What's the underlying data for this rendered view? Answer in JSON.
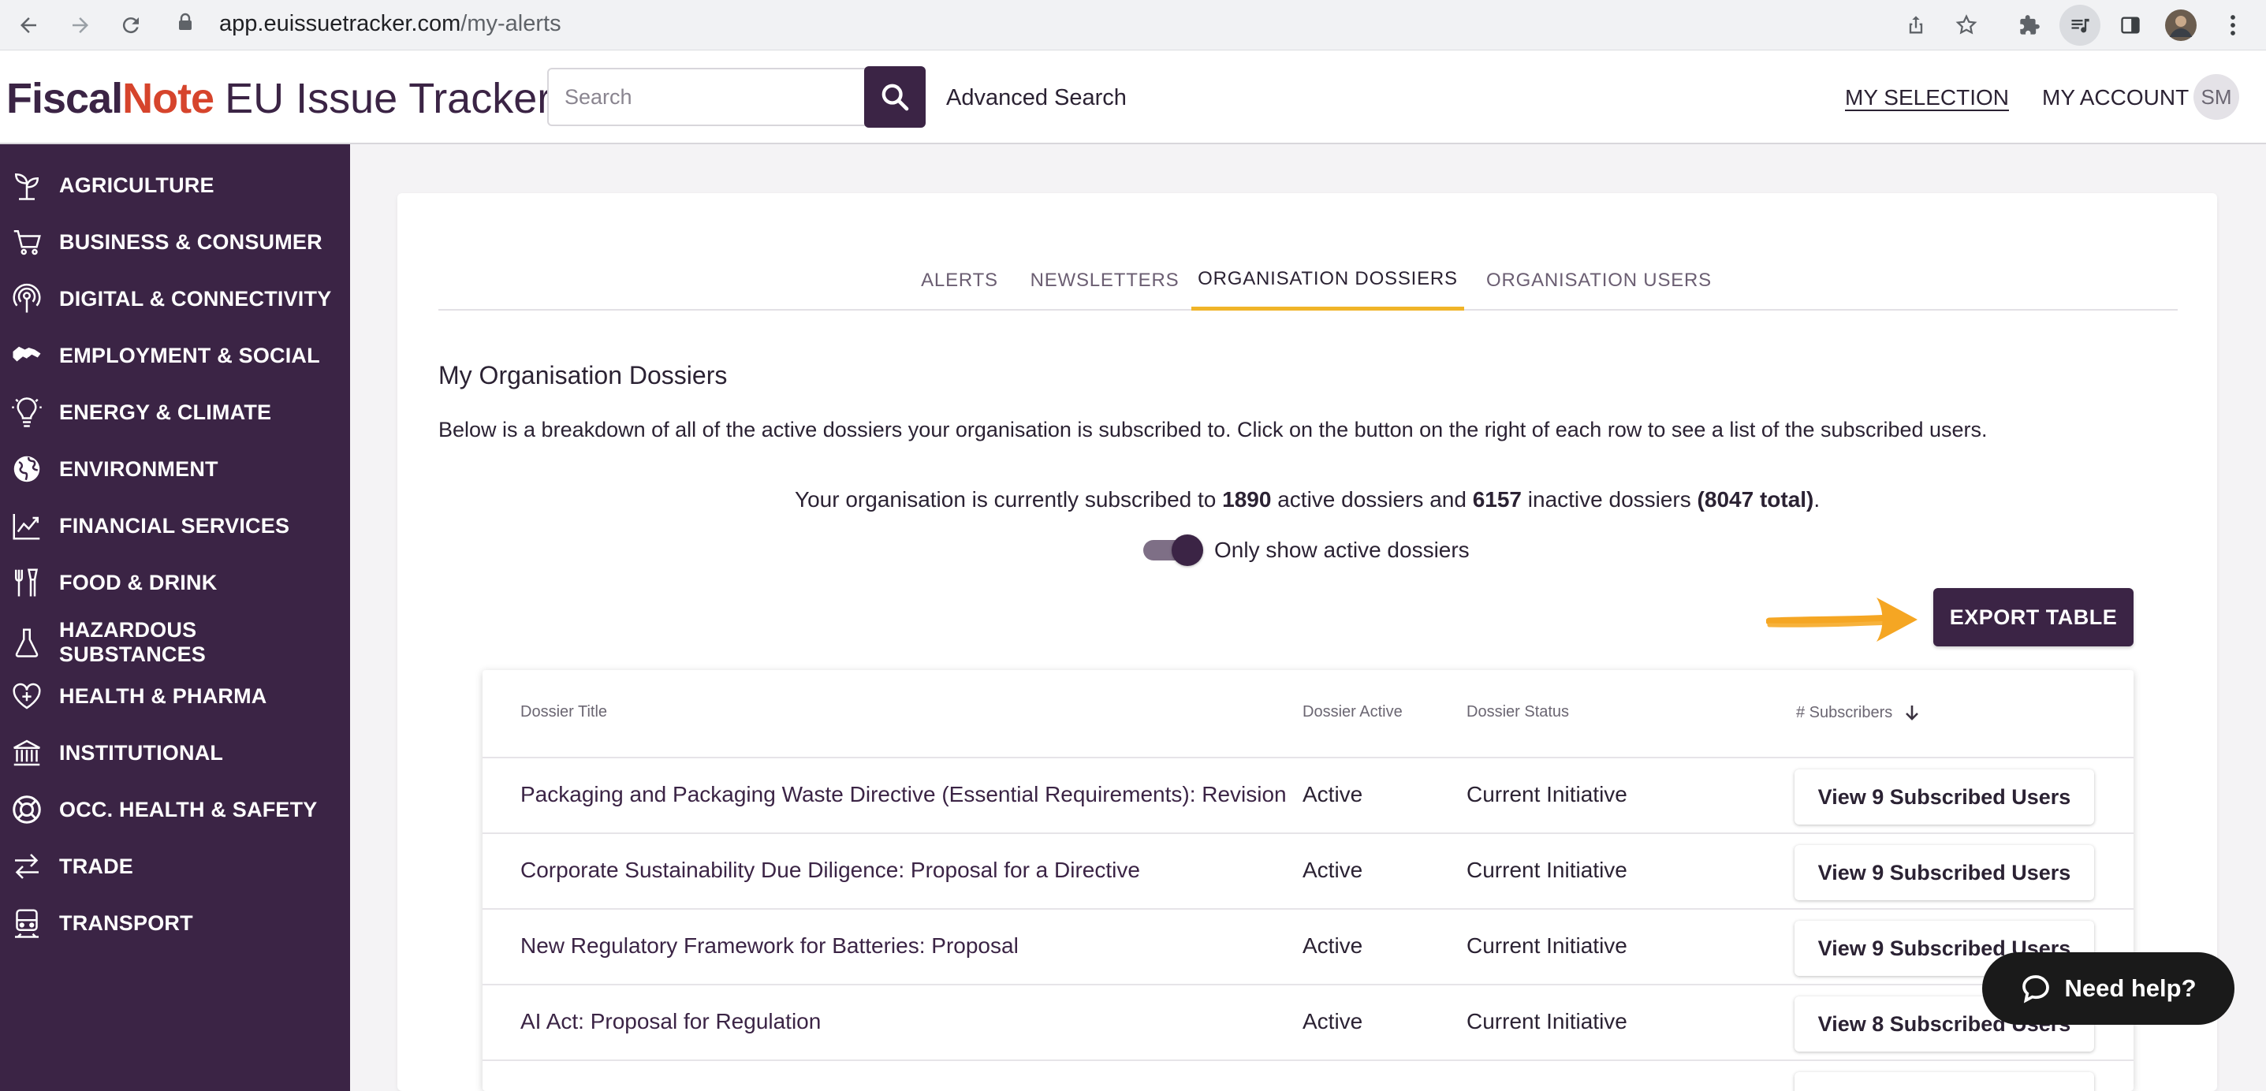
{
  "browser": {
    "url_host": "app.euissuetracker.com",
    "url_path": "/my-alerts"
  },
  "header": {
    "logo_fiscal": "Fiscal",
    "logo_note": "Note",
    "logo_product": "EU Issue Tracker",
    "search_placeholder": "Search",
    "advanced_search": "Advanced Search",
    "my_selection": "MY SELECTION",
    "my_account": "MY ACCOUNT",
    "avatar_initials": "SM"
  },
  "sidebar": {
    "items": [
      {
        "label": "AGRICULTURE",
        "icon": "sprout-icon"
      },
      {
        "label": "BUSINESS & CONSUMER",
        "icon": "cart-icon"
      },
      {
        "label": "DIGITAL & CONNECTIVITY",
        "icon": "broadcast-icon"
      },
      {
        "label": "EMPLOYMENT & SOCIAL",
        "icon": "handshake-icon"
      },
      {
        "label": "ENERGY & CLIMATE",
        "icon": "bulb-icon"
      },
      {
        "label": "ENVIRONMENT",
        "icon": "globe-icon"
      },
      {
        "label": "FINANCIAL SERVICES",
        "icon": "chart-icon"
      },
      {
        "label": "FOOD & DRINK",
        "icon": "cutlery-icon"
      },
      {
        "label": "HAZARDOUS",
        "label2": "SUBSTANCES",
        "icon": "flask-icon"
      },
      {
        "label": "HEALTH & PHARMA",
        "icon": "heart-plus-icon"
      },
      {
        "label": "INSTITUTIONAL",
        "icon": "building-icon"
      },
      {
        "label": "OCC. HEALTH & SAFETY",
        "icon": "lifebuoy-icon"
      },
      {
        "label": "TRADE",
        "icon": "exchange-icon"
      },
      {
        "label": "TRANSPORT",
        "icon": "train-icon"
      }
    ]
  },
  "tabs": [
    {
      "label": "ALERTS"
    },
    {
      "label": "NEWSLETTERS"
    },
    {
      "label": "ORGANISATION DOSSIERS",
      "active": true
    },
    {
      "label": "ORGANISATION USERS"
    }
  ],
  "main": {
    "title": "My Organisation Dossiers",
    "description": "Below is a breakdown of all of the active dossiers your organisation is subscribed to. Click on the button on the right of each row to see a list of the subscribed users.",
    "summary_prefix": "Your organisation is currently subscribed to ",
    "active_count": "1890",
    "summary_mid1": " active dossiers and ",
    "inactive_count": "6157",
    "summary_mid2": " inactive dossiers ",
    "total": "(8047 total)",
    "summary_suffix": ".",
    "toggle_label": "Only show active dossiers",
    "toggle_on": true,
    "export_label": "EXPORT TABLE"
  },
  "table": {
    "headers": {
      "title": "Dossier Title",
      "active": "Dossier Active",
      "status": "Dossier Status",
      "subscribers": "# Subscribers"
    },
    "rows": [
      {
        "title": "Packaging and Packaging Waste Directive (Essential Requirements): Revision",
        "active": "Active",
        "status": "Current Initiative",
        "button": "View 9 Subscribed Users"
      },
      {
        "title": "Corporate Sustainability Due Diligence: Proposal for a Directive",
        "active": "Active",
        "status": "Current Initiative",
        "button": "View 9 Subscribed Users"
      },
      {
        "title": "New Regulatory Framework for Batteries: Proposal",
        "active": "Active",
        "status": "Current Initiative",
        "button": "View 9 Subscribed Users"
      },
      {
        "title": "AI Act: Proposal for Regulation",
        "active": "Active",
        "status": "Current Initiative",
        "button": "View 8 Subscribed Users"
      }
    ]
  },
  "help": {
    "label": "Need help?"
  },
  "colors": {
    "brand": "#3b2445",
    "accent": "#f0b429",
    "logo_red": "#d6442c"
  }
}
